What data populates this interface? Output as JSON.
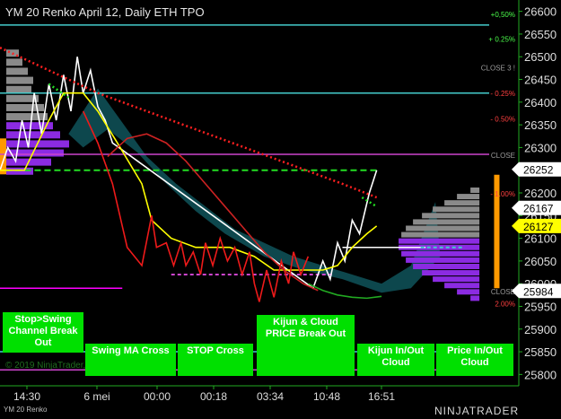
{
  "title": "YM 20 Renko April 12, Daily ETH TPO",
  "instrument_label": "YM 20 Renko",
  "brand": "NINJATRADER",
  "copyright": "© 2019 NinjaTrader, LLC",
  "buttons": {
    "stop_swing": "Stop>Swing Channel Break Out",
    "swing_ma": "Swing MA Cross",
    "stop_cross": "STOP Cross",
    "kijun_cloud": "Kijun & Cloud PRICE Break Out",
    "kijun_inout": "Kijun In/Out Cloud",
    "price_inout": "Price In/Out Cloud"
  },
  "chart_data": {
    "type": "line",
    "x_ticks": [
      "14:30",
      "6 mei",
      "00:00",
      "00:18",
      "03:34",
      "10:48",
      "16:51"
    ],
    "y_ticks": [
      26600,
      26550,
      26500,
      26450,
      26400,
      26350,
      26300,
      26250,
      26200,
      26150,
      26100,
      26050,
      26000,
      25950,
      25900,
      25850,
      25800
    ],
    "ylim": [
      25775,
      26625
    ],
    "price_markers": [
      {
        "value": "26252",
        "color": "#ffffff",
        "y": 26252
      },
      {
        "value": "26167",
        "color": "#ffffff",
        "y": 26167
      },
      {
        "value": "26127",
        "color": "#ffff00",
        "y": 26127
      },
      {
        "value": "25984",
        "color": "#ffffff",
        "y": 25984
      }
    ],
    "percent_labels": [
      {
        "text": "+0,50%",
        "color": "#4cff4c",
        "y": 26595
      },
      {
        "text": "+ 0.25%",
        "color": "#4cff4c",
        "y": 26541
      },
      {
        "text": "CLOSE 3 !",
        "color": "#9a9a9a",
        "y": 26478
      },
      {
        "text": "- 0.25%",
        "color": "#ff4040",
        "y": 26421
      },
      {
        "text": "- 0.50%",
        "color": "#ff4040",
        "y": 26365
      },
      {
        "text": "CLOSE",
        "color": "#9a9a9a",
        "y": 26285
      },
      {
        "text": "- 1.00%",
        "color": "#ff4040",
        "y": 26200
      },
      {
        "text": "CLOSE",
        "color": "#9a9a9a",
        "y": 25985
      },
      {
        "text": "2.00%",
        "color": "#ff4040",
        "y": 25958
      }
    ],
    "series": [
      {
        "color": "#ffffff",
        "values": [
          [
            0,
            26250
          ],
          [
            0.016,
            26300
          ],
          [
            0.032,
            26270
          ],
          [
            0.045,
            26360
          ],
          [
            0.058,
            26300
          ],
          [
            0.07,
            26420
          ],
          [
            0.085,
            26330
          ],
          [
            0.1,
            26440
          ],
          [
            0.115,
            26360
          ],
          [
            0.13,
            26460
          ],
          [
            0.145,
            26380
          ],
          [
            0.158,
            26500
          ],
          [
            0.17,
            26420
          ],
          [
            0.185,
            26470
          ],
          [
            0.2,
            26390
          ],
          [
            0.215,
            26360
          ],
          [
            0.23,
            26310
          ],
          [
            0.64,
            25990
          ],
          [
            0.66,
            26050
          ],
          [
            0.675,
            26010
          ],
          [
            0.69,
            26090
          ],
          [
            0.705,
            26050
          ],
          [
            0.72,
            26140
          ],
          [
            0.735,
            26110
          ],
          [
            0.755,
            26200
          ],
          [
            0.77,
            26250
          ]
        ]
      },
      {
        "color": "#ffff00",
        "values": [
          [
            0,
            26250
          ],
          [
            0.05,
            26250
          ],
          [
            0.1,
            26360
          ],
          [
            0.13,
            26420
          ],
          [
            0.17,
            26420
          ],
          [
            0.2,
            26380
          ],
          [
            0.24,
            26310
          ],
          [
            0.29,
            26220
          ],
          [
            0.31,
            26140
          ],
          [
            0.35,
            26100
          ],
          [
            0.4,
            26080
          ],
          [
            0.47,
            26080
          ],
          [
            0.52,
            26060
          ],
          [
            0.56,
            26030
          ],
          [
            0.63,
            26030
          ],
          [
            0.66,
            26030
          ],
          [
            0.69,
            26040
          ],
          [
            0.72,
            26080
          ],
          [
            0.75,
            26110
          ],
          [
            0.77,
            26127
          ]
        ]
      },
      {
        "color": "#ee1a1a",
        "values": [
          [
            0.17,
            26380
          ],
          [
            0.2,
            26310
          ],
          [
            0.23,
            26220
          ],
          [
            0.26,
            26080
          ],
          [
            0.29,
            26040
          ],
          [
            0.31,
            26150
          ],
          [
            0.32,
            26080
          ],
          [
            0.34,
            26090
          ],
          [
            0.355,
            26040
          ],
          [
            0.37,
            26090
          ],
          [
            0.38,
            26040
          ],
          [
            0.395,
            26070
          ],
          [
            0.41,
            26020
          ],
          [
            0.42,
            26090
          ],
          [
            0.435,
            26040
          ],
          [
            0.45,
            26100
          ],
          [
            0.465,
            26050
          ],
          [
            0.48,
            26080
          ],
          [
            0.495,
            26020
          ],
          [
            0.51,
            26070
          ],
          [
            0.52,
            26000
          ],
          [
            0.53,
            25960
          ],
          [
            0.545,
            26030
          ],
          [
            0.56,
            25970
          ],
          [
            0.575,
            26050
          ],
          [
            0.59,
            26000
          ],
          [
            0.6,
            26070
          ],
          [
            0.615,
            26020
          ],
          [
            0.63,
            26060
          ]
        ]
      },
      {
        "color": "#cc2222",
        "values": [
          [
            0.22,
            26280
          ],
          [
            0.26,
            26320
          ],
          [
            0.3,
            26330
          ],
          [
            0.34,
            26310
          ],
          [
            0.38,
            26270
          ],
          [
            0.42,
            26220
          ],
          [
            0.46,
            26170
          ],
          [
            0.5,
            26120
          ],
          [
            0.54,
            26070
          ],
          [
            0.58,
            26030
          ],
          [
            0.62,
            26000
          ],
          [
            0.65,
            25985
          ]
        ]
      },
      {
        "color": "#22aa22",
        "values": [
          [
            0.63,
            26000
          ],
          [
            0.66,
            25985
          ],
          [
            0.69,
            25975
          ],
          [
            0.72,
            25970
          ],
          [
            0.75,
            25968
          ],
          [
            0.78,
            25972
          ]
        ]
      },
      {
        "color": "#ff2020",
        "dash": "2,3",
        "values": [
          [
            0,
            26520
          ],
          [
            0.1,
            26470
          ],
          [
            0.2,
            26420
          ],
          [
            0.3,
            26380
          ],
          [
            0.4,
            26340
          ],
          [
            0.5,
            26300
          ],
          [
            0.6,
            26260
          ],
          [
            0.7,
            26220
          ],
          [
            0.77,
            26190
          ]
        ]
      },
      {
        "color": "#22dd22",
        "dash": "2,3",
        "values": [
          [
            0.1,
            26440
          ],
          [
            0.14,
            26410
          ]
        ]
      },
      {
        "color": "#22dd22",
        "dash": "2,3",
        "values": [
          [
            0.74,
            26190
          ],
          [
            0.77,
            26170
          ]
        ]
      }
    ],
    "hlines": [
      {
        "y": 26570,
        "color": "#44cccc",
        "x0": 0,
        "x1": 1
      },
      {
        "y": 26420,
        "color": "#44cccc",
        "x0": 0,
        "x1": 1
      },
      {
        "y": 26285,
        "color": "#cc44cc",
        "x0": 0,
        "x1": 1
      },
      {
        "y": 26250,
        "color": "#22dd22",
        "x0": 0.01,
        "x1": 0.77,
        "dash": "7,4"
      },
      {
        "y": 26080,
        "color": "#ffffff",
        "x0": 0.7,
        "x1": 0.87
      },
      {
        "y": 26080,
        "color": "#44cccc",
        "x0": 0.86,
        "x1": 0.95,
        "dash": "4,3"
      },
      {
        "y": 26020,
        "color": "#cc44cc",
        "x0": 0.35,
        "x1": 0.68,
        "dash": "4,3"
      },
      {
        "y": 25990,
        "color": "#ff00ff",
        "x0": 0,
        "x1": 0.25
      },
      {
        "y": 25850,
        "color": "#44cccc",
        "x0": 0,
        "x1": 1
      },
      {
        "y": 25810,
        "color": "#cc44cc",
        "x0": 0,
        "x1": 1
      }
    ]
  }
}
